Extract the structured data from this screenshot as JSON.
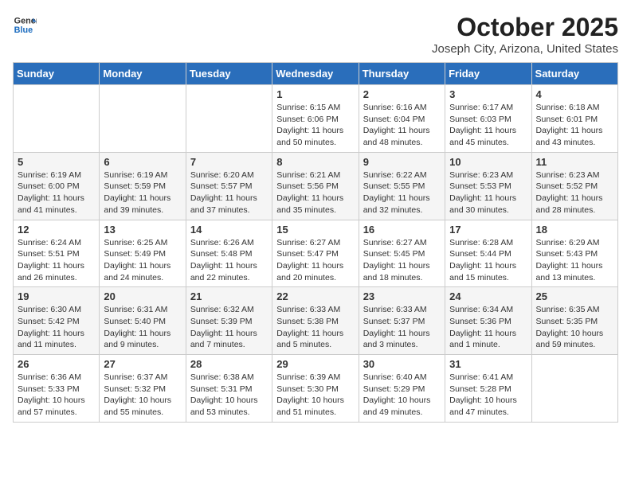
{
  "header": {
    "logo_general": "General",
    "logo_blue": "Blue",
    "month": "October 2025",
    "location": "Joseph City, Arizona, United States"
  },
  "weekdays": [
    "Sunday",
    "Monday",
    "Tuesday",
    "Wednesday",
    "Thursday",
    "Friday",
    "Saturday"
  ],
  "weeks": [
    [
      {
        "day": "",
        "info": ""
      },
      {
        "day": "",
        "info": ""
      },
      {
        "day": "",
        "info": ""
      },
      {
        "day": "1",
        "info": "Sunrise: 6:15 AM\nSunset: 6:06 PM\nDaylight: 11 hours\nand 50 minutes."
      },
      {
        "day": "2",
        "info": "Sunrise: 6:16 AM\nSunset: 6:04 PM\nDaylight: 11 hours\nand 48 minutes."
      },
      {
        "day": "3",
        "info": "Sunrise: 6:17 AM\nSunset: 6:03 PM\nDaylight: 11 hours\nand 45 minutes."
      },
      {
        "day": "4",
        "info": "Sunrise: 6:18 AM\nSunset: 6:01 PM\nDaylight: 11 hours\nand 43 minutes."
      }
    ],
    [
      {
        "day": "5",
        "info": "Sunrise: 6:19 AM\nSunset: 6:00 PM\nDaylight: 11 hours\nand 41 minutes."
      },
      {
        "day": "6",
        "info": "Sunrise: 6:19 AM\nSunset: 5:59 PM\nDaylight: 11 hours\nand 39 minutes."
      },
      {
        "day": "7",
        "info": "Sunrise: 6:20 AM\nSunset: 5:57 PM\nDaylight: 11 hours\nand 37 minutes."
      },
      {
        "day": "8",
        "info": "Sunrise: 6:21 AM\nSunset: 5:56 PM\nDaylight: 11 hours\nand 35 minutes."
      },
      {
        "day": "9",
        "info": "Sunrise: 6:22 AM\nSunset: 5:55 PM\nDaylight: 11 hours\nand 32 minutes."
      },
      {
        "day": "10",
        "info": "Sunrise: 6:23 AM\nSunset: 5:53 PM\nDaylight: 11 hours\nand 30 minutes."
      },
      {
        "day": "11",
        "info": "Sunrise: 6:23 AM\nSunset: 5:52 PM\nDaylight: 11 hours\nand 28 minutes."
      }
    ],
    [
      {
        "day": "12",
        "info": "Sunrise: 6:24 AM\nSunset: 5:51 PM\nDaylight: 11 hours\nand 26 minutes."
      },
      {
        "day": "13",
        "info": "Sunrise: 6:25 AM\nSunset: 5:49 PM\nDaylight: 11 hours\nand 24 minutes."
      },
      {
        "day": "14",
        "info": "Sunrise: 6:26 AM\nSunset: 5:48 PM\nDaylight: 11 hours\nand 22 minutes."
      },
      {
        "day": "15",
        "info": "Sunrise: 6:27 AM\nSunset: 5:47 PM\nDaylight: 11 hours\nand 20 minutes."
      },
      {
        "day": "16",
        "info": "Sunrise: 6:27 AM\nSunset: 5:45 PM\nDaylight: 11 hours\nand 18 minutes."
      },
      {
        "day": "17",
        "info": "Sunrise: 6:28 AM\nSunset: 5:44 PM\nDaylight: 11 hours\nand 15 minutes."
      },
      {
        "day": "18",
        "info": "Sunrise: 6:29 AM\nSunset: 5:43 PM\nDaylight: 11 hours\nand 13 minutes."
      }
    ],
    [
      {
        "day": "19",
        "info": "Sunrise: 6:30 AM\nSunset: 5:42 PM\nDaylight: 11 hours\nand 11 minutes."
      },
      {
        "day": "20",
        "info": "Sunrise: 6:31 AM\nSunset: 5:40 PM\nDaylight: 11 hours\nand 9 minutes."
      },
      {
        "day": "21",
        "info": "Sunrise: 6:32 AM\nSunset: 5:39 PM\nDaylight: 11 hours\nand 7 minutes."
      },
      {
        "day": "22",
        "info": "Sunrise: 6:33 AM\nSunset: 5:38 PM\nDaylight: 11 hours\nand 5 minutes."
      },
      {
        "day": "23",
        "info": "Sunrise: 6:33 AM\nSunset: 5:37 PM\nDaylight: 11 hours\nand 3 minutes."
      },
      {
        "day": "24",
        "info": "Sunrise: 6:34 AM\nSunset: 5:36 PM\nDaylight: 11 hours\nand 1 minute."
      },
      {
        "day": "25",
        "info": "Sunrise: 6:35 AM\nSunset: 5:35 PM\nDaylight: 10 hours\nand 59 minutes."
      }
    ],
    [
      {
        "day": "26",
        "info": "Sunrise: 6:36 AM\nSunset: 5:33 PM\nDaylight: 10 hours\nand 57 minutes."
      },
      {
        "day": "27",
        "info": "Sunrise: 6:37 AM\nSunset: 5:32 PM\nDaylight: 10 hours\nand 55 minutes."
      },
      {
        "day": "28",
        "info": "Sunrise: 6:38 AM\nSunset: 5:31 PM\nDaylight: 10 hours\nand 53 minutes."
      },
      {
        "day": "29",
        "info": "Sunrise: 6:39 AM\nSunset: 5:30 PM\nDaylight: 10 hours\nand 51 minutes."
      },
      {
        "day": "30",
        "info": "Sunrise: 6:40 AM\nSunset: 5:29 PM\nDaylight: 10 hours\nand 49 minutes."
      },
      {
        "day": "31",
        "info": "Sunrise: 6:41 AM\nSunset: 5:28 PM\nDaylight: 10 hours\nand 47 minutes."
      },
      {
        "day": "",
        "info": ""
      }
    ]
  ]
}
